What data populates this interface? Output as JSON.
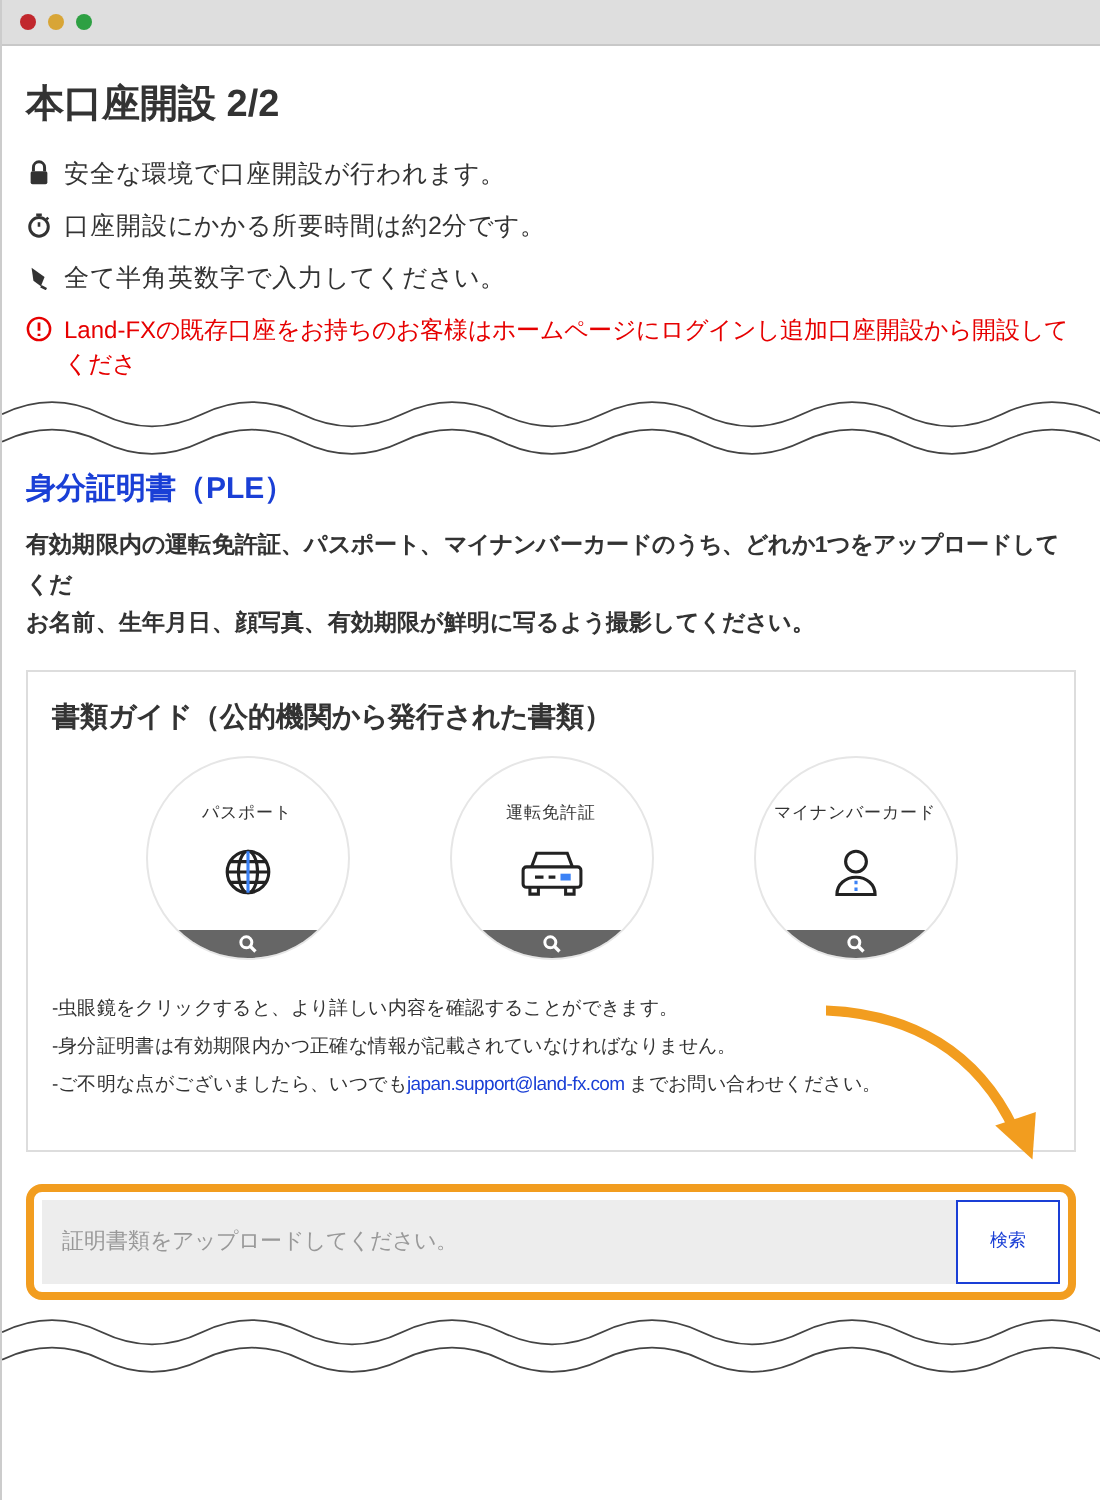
{
  "title": "本口座開設 2/2",
  "notices": [
    {
      "kind": "lock",
      "text": "安全な環境で口座開設が行われます。"
    },
    {
      "kind": "timer",
      "text": "口座開設にかかる所要時間は約2分です。"
    },
    {
      "kind": "pen",
      "text": "全て半角英数字で入力してください。"
    },
    {
      "kind": "warning",
      "text": "Land-FXの既存口座をお持ちのお客様はホームページにログインし追加口座開設から開設してくださ"
    }
  ],
  "section": {
    "heading": "身分証明書（PLE）",
    "description": [
      "有効期限内の運転免許証、パスポート、マイナンバーカードのうち、どれか1つをアップロードしてくだ",
      "お名前、生年月日、顔写真、有効期限が鮮明に写るよう撮影してください。"
    ]
  },
  "guide": {
    "title": "書類ガイド（公的機関から発行された書類）",
    "documents": [
      {
        "kind": "passport",
        "label": "パスポート"
      },
      {
        "kind": "license",
        "label": "運転免許証"
      },
      {
        "kind": "mynumber",
        "label": "マイナンバーカード"
      }
    ],
    "notes": [
      {
        "text": "-虫眼鏡をクリックすると、より詳しい内容を確認することができます。"
      },
      {
        "text": "-身分証明書は有効期限内かつ正確な情報が記載されていなければなりません。"
      },
      {
        "text": "-ご不明な点がございましたら、いつでも",
        "link": "japan.support@land-fx.com",
        "after": "までお問い合わせください。"
      }
    ]
  },
  "upload": {
    "placeholder": "証明書類をアップロードしてください。",
    "button": "検索"
  }
}
